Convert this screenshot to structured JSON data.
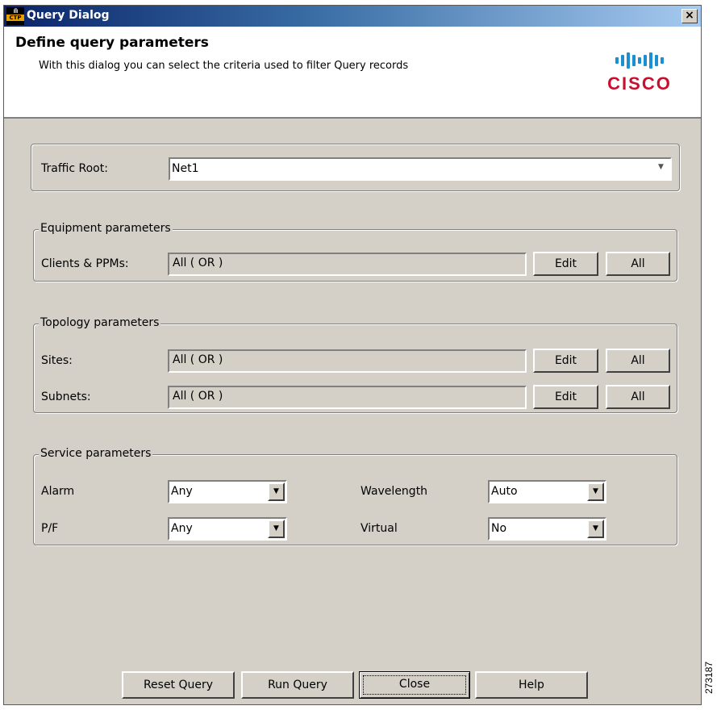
{
  "window": {
    "title": "Query Dialog",
    "icon": "ctp-app-icon",
    "icon_text": "CTP",
    "close_glyph": "×"
  },
  "header": {
    "title": "Define query parameters",
    "description": "With this dialog you can select the criteria used to filter Query records",
    "logo_text": "CISCO"
  },
  "traffic": {
    "label": "Traffic Root:",
    "value": "Net1"
  },
  "equipment": {
    "legend": "Equipment parameters",
    "clients": {
      "label": "Clients & PPMs:",
      "value": "All ( OR )",
      "edit": "Edit",
      "all": "All"
    }
  },
  "topology": {
    "legend": "Topology parameters",
    "sites": {
      "label": "Sites:",
      "value": "All ( OR )",
      "edit": "Edit",
      "all": "All"
    },
    "subnets": {
      "label": "Subnets:",
      "value": "All ( OR )",
      "edit": "Edit",
      "all": "All"
    }
  },
  "service": {
    "legend": "Service parameters",
    "alarm": {
      "label": "Alarm",
      "value": "Any"
    },
    "pf": {
      "label": "P/F",
      "value": "Any"
    },
    "wavelength": {
      "label": "Wavelength",
      "value": "Auto"
    },
    "virtual": {
      "label": "Virtual",
      "value": "No"
    }
  },
  "footer": {
    "reset": "Reset Query",
    "run": "Run Query",
    "close": "Close",
    "help": "Help"
  },
  "side_code": "273187",
  "colors": {
    "titlebar_start": "#0a246a",
    "titlebar_end": "#a6caf0",
    "dialog_bg": "#d4d0c8",
    "cisco_red": "#c8102e",
    "cisco_blue": "#1b8fd1"
  }
}
